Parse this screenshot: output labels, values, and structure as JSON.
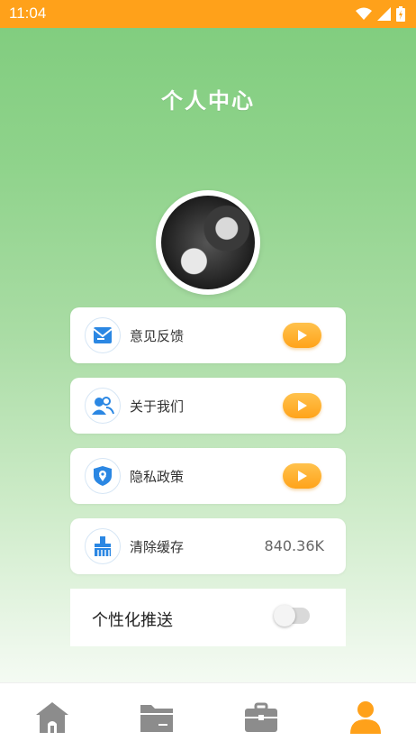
{
  "status_bar": {
    "time": "11:04"
  },
  "header": {
    "title": "个人中心"
  },
  "menu": {
    "feedback": {
      "label": "意见反馈"
    },
    "about": {
      "label": "关于我们"
    },
    "privacy": {
      "label": "隐私政策"
    },
    "cache": {
      "label": "清除缓存",
      "value": "840.36K"
    }
  },
  "push": {
    "label": "个性化推送",
    "enabled": false
  },
  "tabbar": {
    "active_tab": "profile"
  },
  "colors": {
    "status_bar": "#ffa11a",
    "accent_orange": "#ffa31a",
    "icon_blue": "#2b87e3",
    "tab_gray": "#8c8c8c",
    "tab_active": "#ffa11a"
  }
}
